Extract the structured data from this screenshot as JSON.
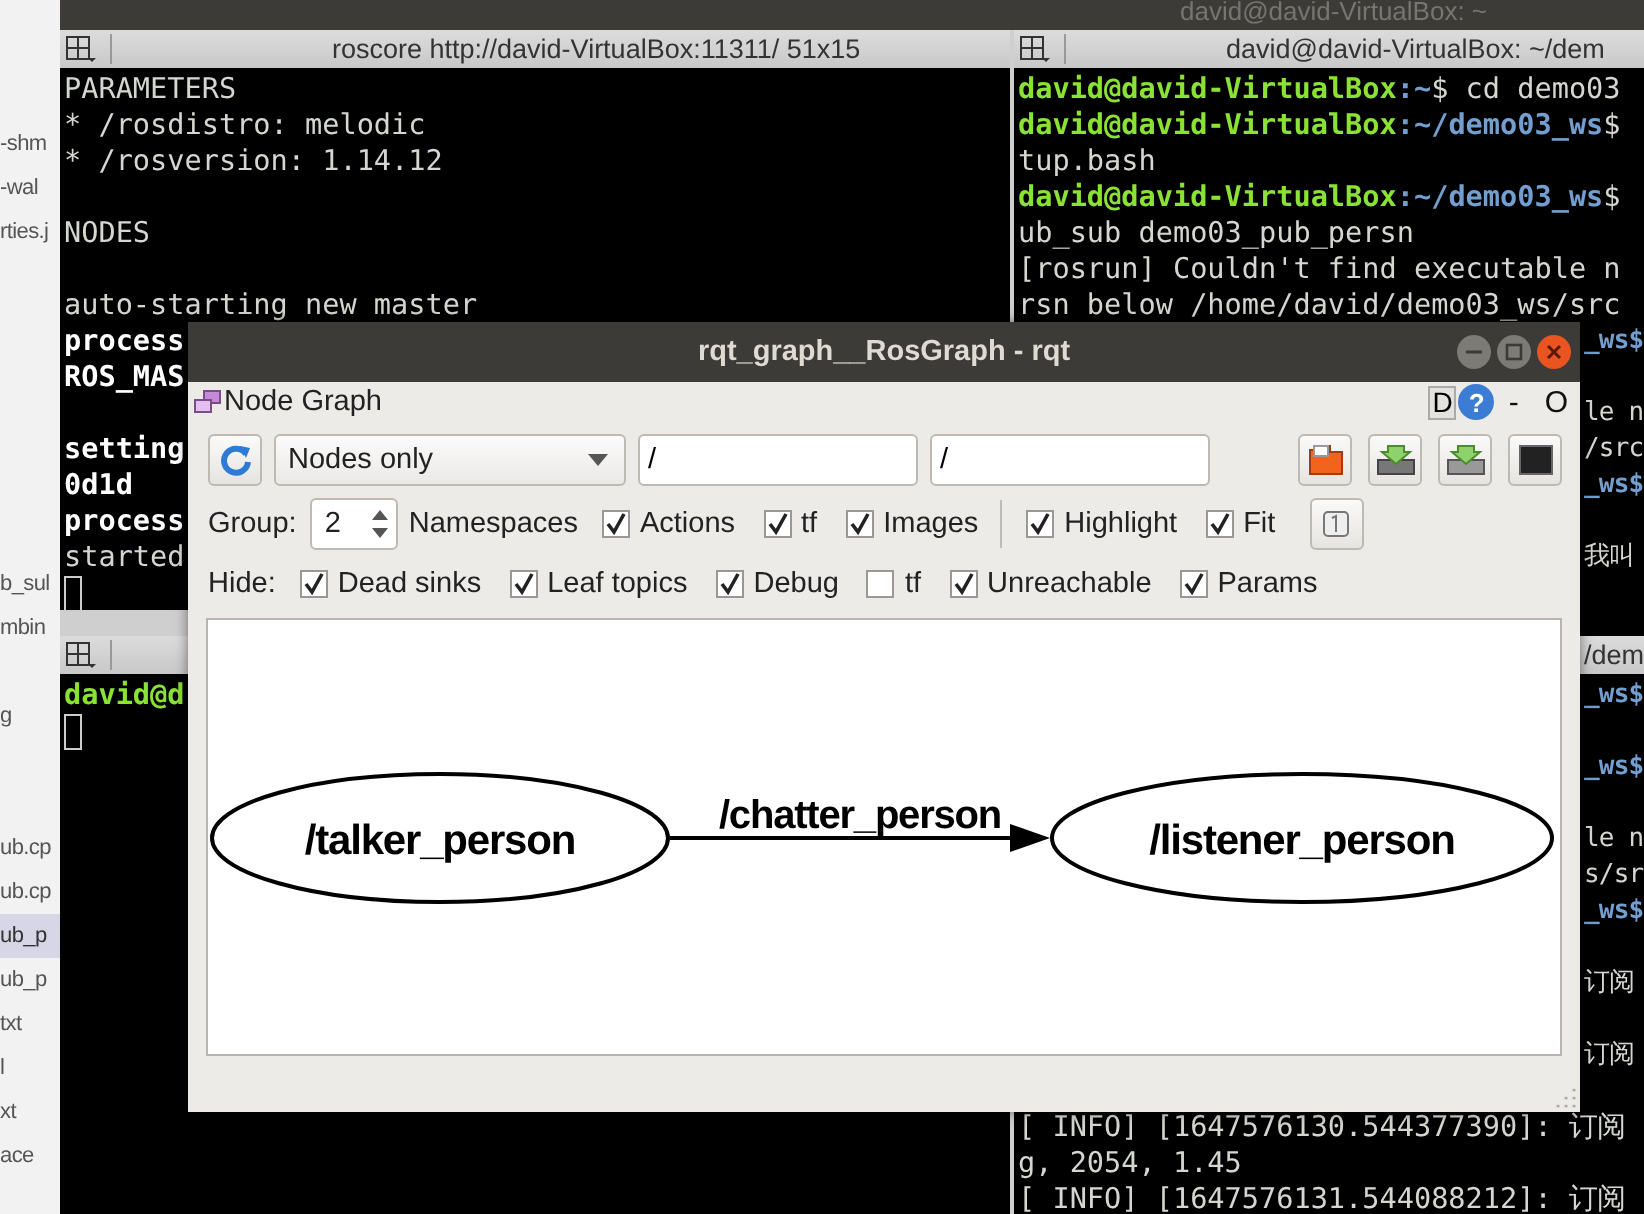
{
  "desktop_title": "david@david-VirtualBox: ~",
  "file_list": [
    {
      "name": "-shm",
      "selected": false
    },
    {
      "name": "-wal",
      "selected": false
    },
    {
      "name": "rties.j",
      "selected": false
    },
    {
      "name": "b_sul",
      "selected": false
    },
    {
      "name": "mbin",
      "selected": false
    },
    {
      "name": "g",
      "selected": false
    },
    {
      "name": "ub.cp",
      "selected": false
    },
    {
      "name": "ub.cp",
      "selected": false
    },
    {
      "name": "ub_p",
      "selected": true
    },
    {
      "name": "ub_p",
      "selected": false
    },
    {
      "name": "txt",
      "selected": false
    },
    {
      "name": "l",
      "selected": false
    },
    {
      "name": "xt",
      "selected": false
    },
    {
      "name": "ace",
      "selected": false
    }
  ],
  "terminals": [
    {
      "title": "roscore http://david-VirtualBox:11311/ 51x15",
      "cursor": true,
      "lines": [
        {
          "kind": "plain",
          "text": "PARAMETERS"
        },
        {
          "kind": "plain",
          "text": " * /rosdistro: melodic"
        },
        {
          "kind": "plain",
          "text": " * /rosversion: 1.14.12"
        },
        {
          "kind": "plain",
          "text": "NODES",
          "blank_before": true
        },
        {
          "kind": "plain",
          "text": "auto-starting new master",
          "blank_before": true
        },
        {
          "kind": "bold",
          "text": "process"
        },
        {
          "kind": "bold",
          "text": "ROS_MAS"
        },
        {
          "kind": "bold",
          "text": "setting",
          "blank_before": true
        },
        {
          "kind": "bold",
          "text": "0d1d"
        },
        {
          "kind": "bold",
          "text": "process"
        },
        {
          "kind": "plain",
          "text": "started"
        }
      ]
    },
    {
      "cursor": true,
      "lines": [
        {
          "kind": "prompt",
          "user": "david@d"
        }
      ]
    },
    {
      "title": "david@david-VirtualBox: ~/dem",
      "lines": [
        {
          "kind": "prompt",
          "user": "david@david-VirtualBox",
          "path": ":~",
          "text": "$ cd demo03"
        },
        {
          "kind": "prompt",
          "user": "david@david-VirtualBox",
          "path": ":~/demo03_ws",
          "text": "$"
        },
        {
          "kind": "plain",
          "text": "tup.bash"
        },
        {
          "kind": "prompt",
          "user": "david@david-VirtualBox",
          "path": ":~/demo03_ws",
          "text": "$"
        },
        {
          "kind": "plain",
          "text": "ub_sub demo03_pub_persn"
        },
        {
          "kind": "plain",
          "text": "[rosrun] Couldn't find executable n"
        },
        {
          "kind": "plain",
          "text": "rsn below /home/david/demo03_ws/src"
        },
        {
          "kind": "tail_path",
          "text": "_ws$"
        },
        {
          "kind": "tail",
          "text": "le n",
          "blank_before": true
        },
        {
          "kind": "tail",
          "text": "/src"
        },
        {
          "kind": "tail_path",
          "text": "_ws$"
        },
        {
          "kind": "tail",
          "text": "我叫",
          "blank_before": true
        }
      ]
    },
    {
      "title": "/dem",
      "lines": [
        {
          "kind": "tail_path",
          "text": "_ws$"
        },
        {
          "kind": "tail_path",
          "text": "_ws$",
          "blank_before": true
        },
        {
          "kind": "tail",
          "text": "le n",
          "blank_before": true
        },
        {
          "kind": "tail",
          "text": "s/sr"
        },
        {
          "kind": "tail_path",
          "text": "_ws$"
        },
        {
          "kind": "tail",
          "text": "订阅",
          "blank_before": true
        },
        {
          "kind": "tail",
          "text": "订阅",
          "blank_before": true
        },
        {
          "kind": "plain",
          "text": "[ INFO] [1647576130.544377390]: 订阅",
          "blank_before": true
        },
        {
          "kind": "plain",
          "text": "g, 2054, 1.45"
        },
        {
          "kind": "plain",
          "text": "[ INFO] [1647576131.544088212]: 订阅"
        }
      ]
    }
  ],
  "rqt": {
    "title": "rqt_graph__RosGraph - rqt",
    "plugin_title": "Node Graph",
    "plugin_button": "D",
    "help_button": "?",
    "dock_buttons": [
      "-",
      "O"
    ],
    "mode": "Nodes only",
    "filters": [
      "/",
      "/"
    ],
    "group_label": "Group:",
    "group_value": "2",
    "namespaces_label": "Namespaces",
    "options": [
      {
        "label": "Actions",
        "checked": true
      },
      {
        "label": "tf",
        "checked": true
      },
      {
        "label": "Images",
        "checked": true
      }
    ],
    "view_options": [
      {
        "label": "Highlight",
        "checked": true
      },
      {
        "label": "Fit",
        "checked": true
      }
    ],
    "hide_label": "Hide:",
    "hide": [
      {
        "label": "Dead sinks",
        "checked": true
      },
      {
        "label": "Leaf topics",
        "checked": true
      },
      {
        "label": "Debug",
        "checked": true
      },
      {
        "label": "tf",
        "checked": false
      },
      {
        "label": "Unreachable",
        "checked": true
      },
      {
        "label": "Params",
        "checked": true
      }
    ],
    "graph": {
      "nodes": [
        {
          "label": "/talker_person"
        },
        {
          "label": "/listener_person"
        }
      ],
      "edges": [
        {
          "label": "/chatter_person"
        }
      ]
    }
  }
}
